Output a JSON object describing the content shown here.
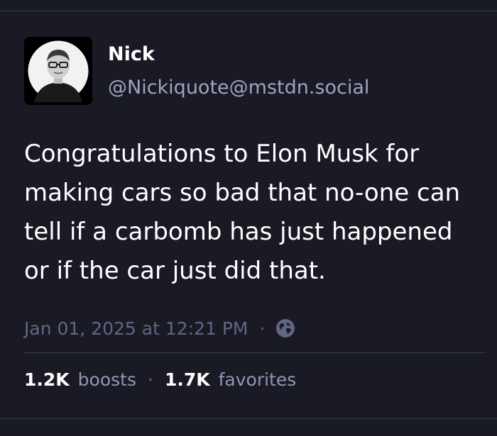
{
  "author": {
    "display_name": "Nick",
    "handle": "@Nickiquote@mstdn.social",
    "avatar_icon": "avatar-portrait"
  },
  "post": {
    "lines": [
      "Congratulations to Elon Musk for",
      "making cars so bad that no-one can",
      "tell if a carbomb has just happened",
      "or if the car just did that."
    ]
  },
  "meta": {
    "timestamp": "Jan 01, 2025 at 12:21 PM",
    "separator": "·",
    "visibility_icon": "globe-icon"
  },
  "stats": {
    "boosts_count": "1.2K",
    "boosts_label": "boosts",
    "separator": "·",
    "favorites_count": "1.7K",
    "favorites_label": "favorites"
  },
  "colors": {
    "background": "#191a24",
    "text": "#ffffff",
    "handle": "#9fa4c2",
    "muted": "#616683",
    "divider": "#393a4b"
  }
}
